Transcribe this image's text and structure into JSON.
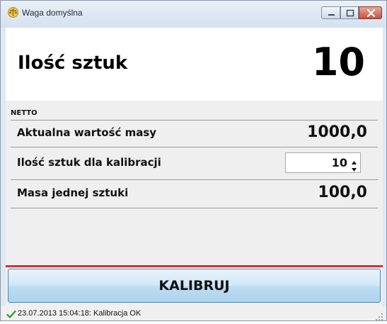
{
  "window": {
    "title": "Waga domyślna",
    "icons": {
      "app": "scale-icon",
      "minimize": "minimize-icon",
      "maximize": "maximize-icon",
      "close": "close-icon"
    }
  },
  "header": {
    "label": "Ilość sztuk",
    "value": "10"
  },
  "netto_label": "NETTO",
  "rows": [
    {
      "label": "Aktualna wartość masy",
      "value": "1000,0"
    },
    {
      "label": "Ilość sztuk dla kalibracji",
      "value": "10"
    },
    {
      "label": "Masa jednej sztuki",
      "value": "100,0"
    }
  ],
  "calibrate_button": "KALIBRUJ",
  "status": {
    "icon": "checkmark-icon",
    "text": "23.07.2013 15:04:18: Kalibracja OK"
  },
  "colors": {
    "accent_line": "#d3313a",
    "button_blue": "#bfdcf2",
    "status_ok": "#2f9a2f"
  }
}
